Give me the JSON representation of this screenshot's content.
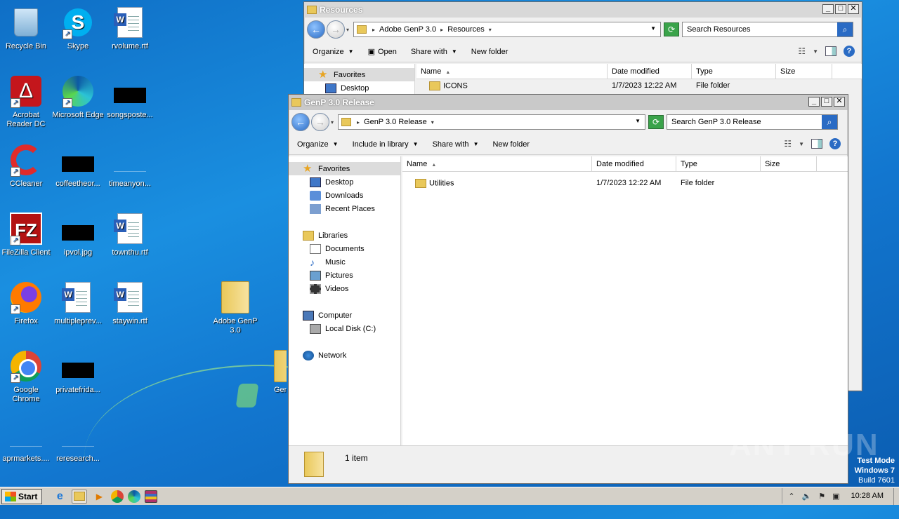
{
  "desktop": {
    "icons": [
      {
        "id": "recycle",
        "label": "Recycle Bin"
      },
      {
        "id": "skype",
        "label": "Skype"
      },
      {
        "id": "rvolume",
        "label": "rvolume.rtf"
      },
      {
        "id": "acrobat",
        "label": "Acrobat Reader DC"
      },
      {
        "id": "edge",
        "label": "Microsoft Edge"
      },
      {
        "id": "songsposte",
        "label": "songsposte..."
      },
      {
        "id": "ccleaner",
        "label": "CCleaner"
      },
      {
        "id": "coffeetheor",
        "label": "coffeetheor..."
      },
      {
        "id": "timeanyon",
        "label": "timeanyon..."
      },
      {
        "id": "filezilla",
        "label": "FileZilla Client"
      },
      {
        "id": "ipvol",
        "label": "ipvol.jpg"
      },
      {
        "id": "townthu",
        "label": "townthu.rtf"
      },
      {
        "id": "firefox",
        "label": "Firefox"
      },
      {
        "id": "multipleprev",
        "label": "multipleprev..."
      },
      {
        "id": "staywin",
        "label": "staywin.rtf"
      },
      {
        "id": "adobegenp",
        "label": "Adobe GenP 3.0"
      },
      {
        "id": "chrome",
        "label": "Google Chrome"
      },
      {
        "id": "privatefrida",
        "label": "privatefrida..."
      },
      {
        "id": "genprel",
        "label": "GenP Rel"
      },
      {
        "id": "aprmarkets",
        "label": "aprmarkets...."
      },
      {
        "id": "reresearch",
        "label": "reresearch..."
      }
    ]
  },
  "window_back": {
    "title": "Resources",
    "breadcrumb": [
      "Adobe GenP 3.0",
      "Resources"
    ],
    "search_placeholder": "Search Resources",
    "toolbar": {
      "organize": "Organize",
      "open": "Open",
      "share_with": "Share with",
      "new_folder": "New folder"
    },
    "nav": {
      "favorites": "Favorites",
      "desktop": "Desktop"
    },
    "columns": [
      "Name",
      "Date modified",
      "Type",
      "Size"
    ],
    "rows": [
      {
        "name": "ICONS",
        "date": "1/7/2023 12:22 AM",
        "type": "File folder",
        "size": ""
      }
    ]
  },
  "window_front": {
    "title": "GenP 3.0 Release",
    "breadcrumb": [
      "GenP 3.0 Release"
    ],
    "search_placeholder": "Search GenP 3.0 Release",
    "toolbar": {
      "organize": "Organize",
      "include": "Include in library",
      "share_with": "Share with",
      "new_folder": "New folder"
    },
    "nav": {
      "favorites": "Favorites",
      "desktop": "Desktop",
      "downloads": "Downloads",
      "recent": "Recent Places",
      "libraries": "Libraries",
      "documents": "Documents",
      "music": "Music",
      "pictures": "Pictures",
      "videos": "Videos",
      "computer": "Computer",
      "localdisk": "Local Disk (C:)",
      "network": "Network"
    },
    "columns": [
      "Name",
      "Date modified",
      "Type",
      "Size"
    ],
    "rows": [
      {
        "name": "Utilities",
        "date": "1/7/2023 12:22 AM",
        "type": "File folder",
        "size": ""
      }
    ],
    "status": "1 item"
  },
  "taskbar": {
    "start": "Start",
    "clock": "10:28 AM"
  },
  "watermark": {
    "line1": "Test Mode",
    "line2": "Windows 7",
    "line3": "Build 7601"
  },
  "brand": "ANY RUN"
}
